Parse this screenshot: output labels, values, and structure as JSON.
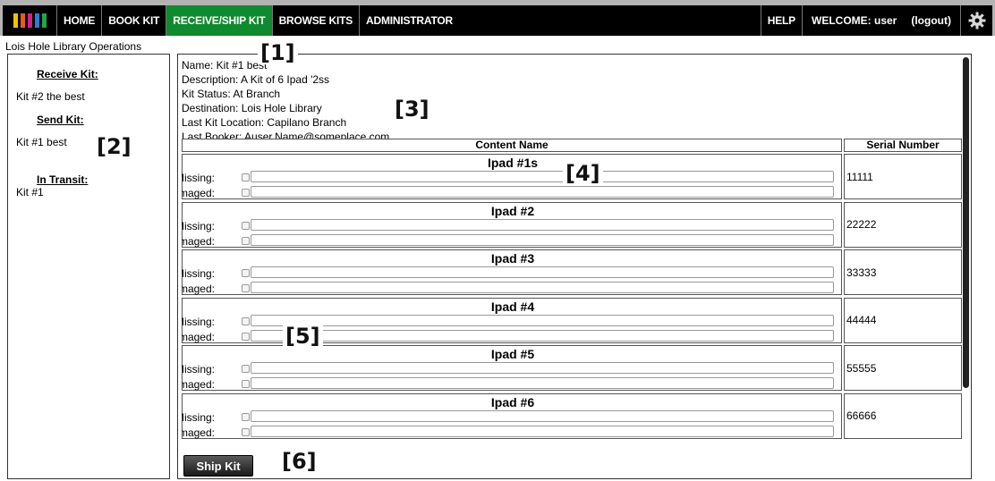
{
  "nav": {
    "logo_colors": [
      "#f2c200",
      "#e85a1a",
      "#d0218b",
      "#2a7fd4",
      "#1fa84a"
    ],
    "items": [
      "HOME",
      "BOOK KIT",
      "RECEIVE/SHIP KIT",
      "BROWSE KITS",
      "ADMINISTRATOR"
    ],
    "active_item": "RECEIVE/SHIP KIT",
    "help": "HELP",
    "welcome": "WELCOME: user",
    "logout": "(logout)",
    "settings_icon": "gear-icon"
  },
  "page_title": "Lois Hole Library Operations",
  "sidebar": {
    "receive_heading": "Receive Kit:",
    "receive_items": [
      "Kit #2 the best"
    ],
    "send_heading": "Send Kit:",
    "send_items": [
      "Kit #1  best"
    ],
    "transit_heading": "In Transit:",
    "transit_items": [
      "Kit #1"
    ]
  },
  "kit_info": {
    "name": "Name: Kit #1  best",
    "description": "Description: A Kit of 6 Ipad '2ss",
    "status": "Kit Status: At Branch",
    "destination": "Destination: Lois Hole Library",
    "last_location": "Last Kit Location: Capilano Branch",
    "last_booker": "Last Booker: Auser.Name@someplace.com"
  },
  "table": {
    "headers": [
      "Content Name",
      "Serial Number"
    ],
    "missing_label": "Missing:",
    "damaged_label": "Damaged:",
    "rows": [
      {
        "name": "Ipad #1s",
        "serial": "11111"
      },
      {
        "name": "Ipad #2",
        "serial": "22222"
      },
      {
        "name": "Ipad #3",
        "serial": "33333"
      },
      {
        "name": "Ipad #4",
        "serial": "44444"
      },
      {
        "name": "Ipad #5",
        "serial": "55555"
      },
      {
        "name": "Ipad #6",
        "serial": "66666"
      }
    ]
  },
  "ship_button": "Ship Kit",
  "callouts": [
    "[1]",
    "[2]",
    "[3]",
    "[4]",
    "[5]",
    "[6]"
  ]
}
